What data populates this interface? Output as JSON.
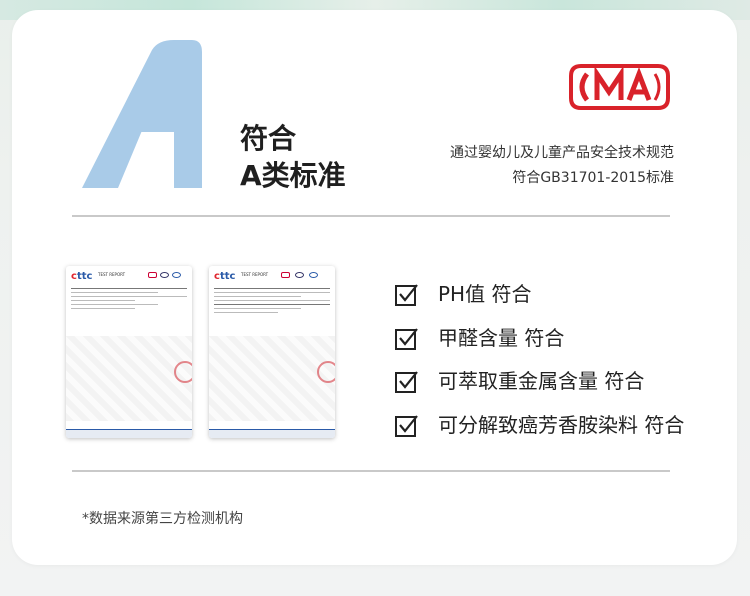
{
  "heading": {
    "line1": "符合",
    "line2": "A类标准"
  },
  "letter": "A",
  "cma_logo_text": "CMA",
  "certification": {
    "line1": "通过婴幼儿及儿童产品安全技术规范",
    "line2": "符合GB31701-2015标准"
  },
  "reports": [
    {
      "logo": "cttc",
      "subtitle": "TEST REPORT"
    },
    {
      "logo": "cttc",
      "subtitle": "TEST REPORT"
    }
  ],
  "checklist": [
    {
      "label": "PH值 符合"
    },
    {
      "label": "甲醛含量 符合"
    },
    {
      "label": "可萃取重金属含量 符合"
    },
    {
      "label": "可分解致癌芳香胺染料 符合"
    }
  ],
  "footnote": "*数据来源第三方检测机构",
  "colors": {
    "letter_blue": "#a9cbe8",
    "cma_red": "#d9222a",
    "divider": "#c9c9c9"
  },
  "icons": {
    "check": "checkbox-check-icon"
  }
}
